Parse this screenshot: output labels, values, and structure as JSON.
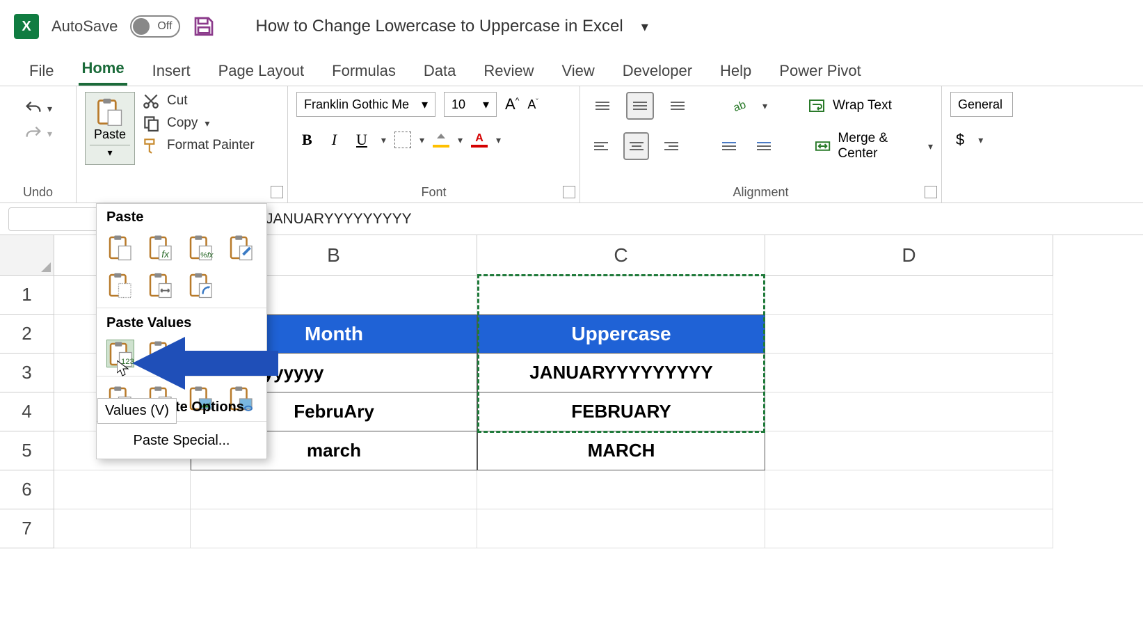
{
  "title_bar": {
    "app_short": "X",
    "autosave_label": "AutoSave",
    "autosave_state": "Off",
    "doc_title": "How to Change Lowercase to Uppercase in Excel"
  },
  "tabs": [
    "File",
    "Home",
    "Insert",
    "Page Layout",
    "Formulas",
    "Data",
    "Review",
    "View",
    "Developer",
    "Help",
    "Power Pivot"
  ],
  "active_tab": "Home",
  "ribbon": {
    "undo_group": "Undo",
    "paste_label": "Paste",
    "cut": "Cut",
    "copy": "Copy",
    "format_painter": "Format Painter",
    "font_group": "Font",
    "font_name": "Franklin Gothic Me",
    "font_size": "10",
    "alignment_group": "Alignment",
    "wrap_text": "Wrap Text",
    "merge_center": "Merge & Center",
    "number_format": "General"
  },
  "formula_bar": {
    "value": "JANUARYYYYYYYYY"
  },
  "columns": [
    "B",
    "C",
    "D"
  ],
  "rows": [
    "1",
    "2",
    "3",
    "4",
    "5",
    "6",
    "7"
  ],
  "sheet": {
    "header_B": "Month",
    "header_C": "Uppercase",
    "data": [
      {
        "B": "nuaryyyyyyyyy",
        "C": "JANUARYYYYYYYYY"
      },
      {
        "B": "FebruAry",
        "C": "FEBRUARY"
      },
      {
        "B": "march",
        "C": "MARCH"
      }
    ]
  },
  "paste_menu": {
    "header1": "Paste",
    "header2": "Paste Values",
    "header3_suffix": "te Options",
    "tooltip": "Values (V)",
    "special": "Paste Special..."
  }
}
